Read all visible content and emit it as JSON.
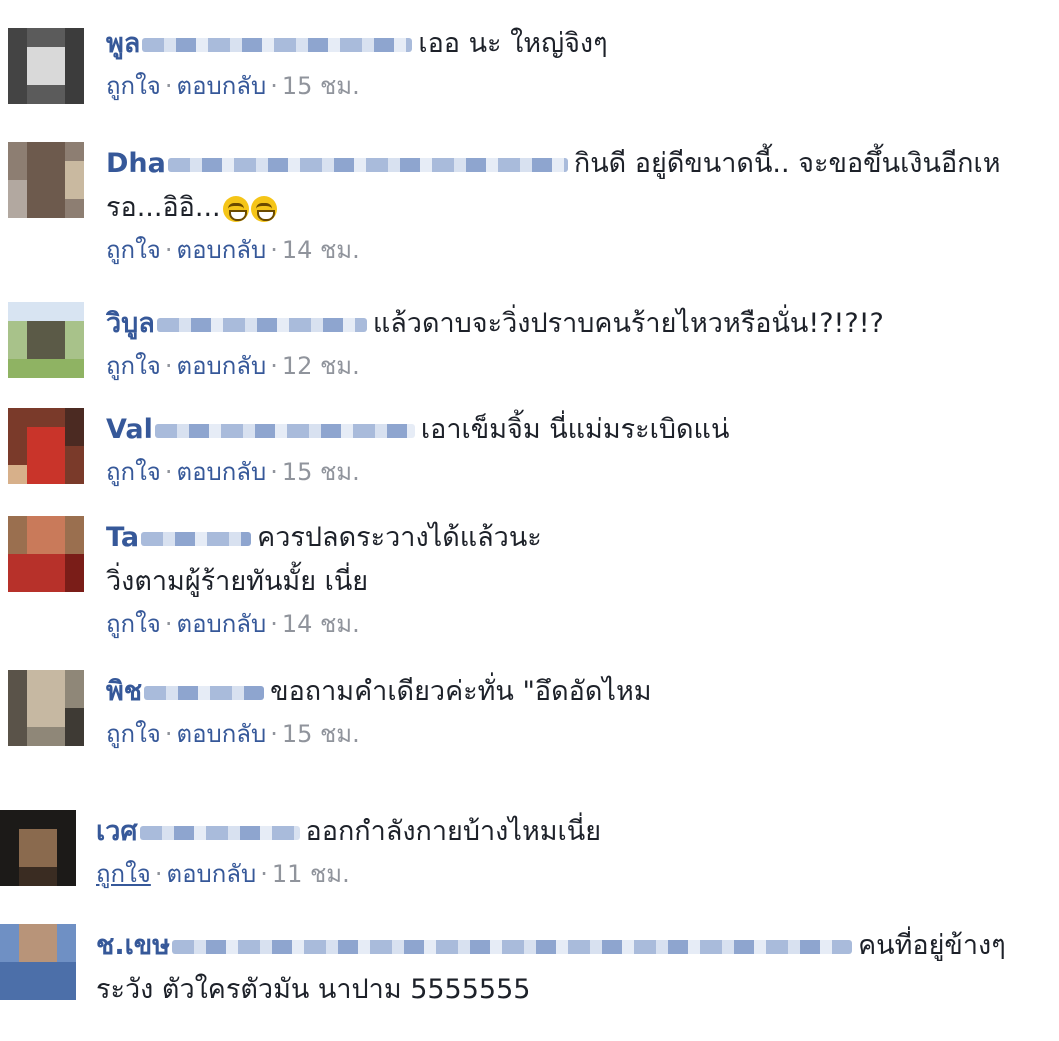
{
  "comments": [
    {
      "name": "พูล",
      "text": "เออ นะ ใหญ่จิงๆ",
      "text2": "",
      "like": "ถูกใจ",
      "reply": "ตอบกลับ",
      "time": "15 ชม.",
      "avatar": "grey-blur",
      "blur_w": 270
    },
    {
      "name": "Dha",
      "text": "กินดี อยู่ดีขนาดนี้.. จะขอขึ้นเงินอีกเห",
      "text2": "รอ...อิอิ...",
      "like": "ถูกใจ",
      "reply": "ตอบกลับ",
      "time": "14 ชม.",
      "avatar": "brown-blur",
      "blur_w": 400,
      "emoji": true
    },
    {
      "name": "วิบูล",
      "text": "แล้วดาบจะวิ่งปราบคนร้ายไหวหรือนั่น!?!?!?",
      "text2": "",
      "like": "ถูกใจ",
      "reply": "ตอบกลับ",
      "time": "12 ชม.",
      "avatar": "green-blur",
      "blur_w": 210
    },
    {
      "name": "Val",
      "text": "เอาเข็มจิ้ม นี่แม่มระเบิดแน่",
      "text2": "",
      "like": "ถูกใจ",
      "reply": "ตอบกลับ",
      "time": "15 ชม.",
      "avatar": "red-blur",
      "blur_w": 260
    },
    {
      "name": "Ta",
      "text": "ควรปลดระวางได้แล้วนะ",
      "text2": "วิ่งตามผู้ร้ายทันมั้ย เนี่ย",
      "like": "ถูกใจ",
      "reply": "ตอบกลับ",
      "time": "14 ชม.",
      "avatar": "red2-blur",
      "blur_w": 110
    },
    {
      "name": "พิช",
      "text": "ขอถามคำเดียวค่ะทั่น \"อึดอัดไหม",
      "text2": "",
      "like": "ถูกใจ",
      "reply": "ตอบกลับ",
      "time": "15 ชม.",
      "avatar": "beige-blur",
      "blur_w": 120
    },
    {
      "name": "เวศ",
      "text": "ออกกำลังกายบ้างไหมเนี่ย",
      "text2": "",
      "like": "ถูกใจ",
      "reply": "ตอบกลับ",
      "time": "11 ชม.",
      "avatar": "dark-blur",
      "blur_w": 160,
      "like_underline": true
    },
    {
      "name": "ช.เขษ",
      "text": "คนที่อยู่ข้างๆ",
      "text2": "ระวัง ตัวใครตัวมัน นาปาม 5555555",
      "like": "",
      "reply": "",
      "time": "",
      "avatar": "blue-blur",
      "blur_w": 680
    }
  ]
}
